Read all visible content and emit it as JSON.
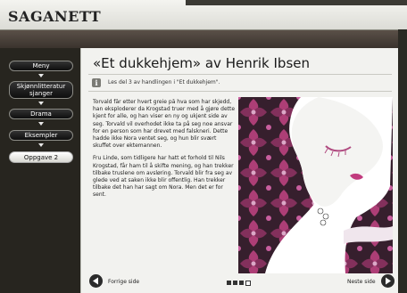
{
  "app": {
    "logo": "SAGANETT"
  },
  "sidebar": {
    "items": [
      {
        "label": "Meny",
        "active": false
      },
      {
        "label": "Skjønnlitteratur sjanger",
        "active": false
      },
      {
        "label": "Drama",
        "active": false
      },
      {
        "label": "Eksempler",
        "active": false
      },
      {
        "label": "Oppgave 2",
        "active": true
      }
    ]
  },
  "content": {
    "title": "«Et dukkehjem» av Henrik Ibsen",
    "info_icon": "info-icon",
    "info_text": "Les del 3 av handlingen i \"Et dukkehjem\".",
    "paragraphs": [
      "Torvald får etter hvert greie på hva som har skjedd, han eksploderer da Krogstad truer med å gjøre dette kjent for alle, og han viser en ny og ukjent side av seg. Torvald vil overhodet ikke ta på seg noe ansvar for en person som har drevet med falskneri. Dette hadde ikke Nora ventet seg, og hun blir svært skuffet over ektemannen.",
      "Fru Linde, som tidligere har hatt et forhold til Nils Krogstad, får ham til å skifte mening, og han trekker tilbake truslene om avsløring. Torvald blir fra seg av glede ved at saken ikke blir offentlig. Han trekker tilbake det han har sagt om Nora. Men det er for sent."
    ]
  },
  "footer": {
    "prev_label": "Forrige side",
    "next_label": "Neste side",
    "page_indicator": {
      "total": 4,
      "current": 3
    }
  },
  "colors": {
    "accent_pink": "#a8326e",
    "dark_bg": "#2b2a24"
  }
}
